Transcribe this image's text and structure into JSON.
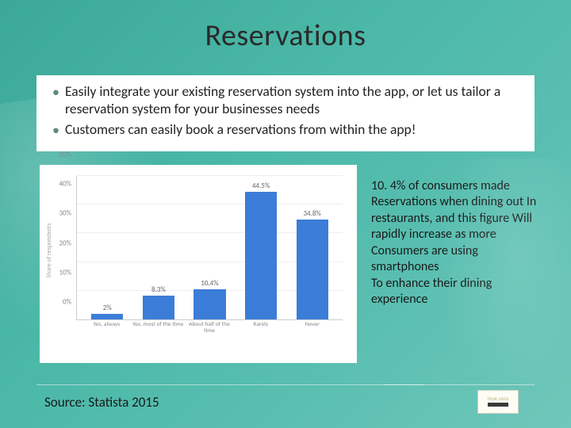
{
  "title": "Reservations",
  "bullets": [
    "Easily integrate your existing reservation system into the app, or let us tailor a reservation system for your businesses needs",
    "Customers can easily book a reservations from within the app!"
  ],
  "side_text": "10. 4% of consumers made Reservations when dining out In restaurants, and this figure Will rapidly increase as more Consumers are using smartphones\nTo enhance their dining experience",
  "source": "Source: Statista 2015",
  "logo_top": "YOUR LOGO",
  "chart_data": {
    "type": "bar",
    "title": "",
    "xlabel": "",
    "ylabel": "Share of respondents",
    "ylim": [
      0,
      50
    ],
    "y_ticks": [
      0,
      10,
      20,
      30,
      40,
      50
    ],
    "y_tick_labels": [
      "0%",
      "10%",
      "20%",
      "30%",
      "40%",
      "50%"
    ],
    "categories": [
      "Yes, always",
      "Yes, most of the time",
      "About half of the time",
      "Rarely",
      "Never"
    ],
    "values": [
      2,
      8.3,
      10.4,
      44.5,
      34.8
    ],
    "value_labels": [
      "2%",
      "8.3%",
      "10.4%",
      "44.5%",
      "34.8%"
    ]
  }
}
